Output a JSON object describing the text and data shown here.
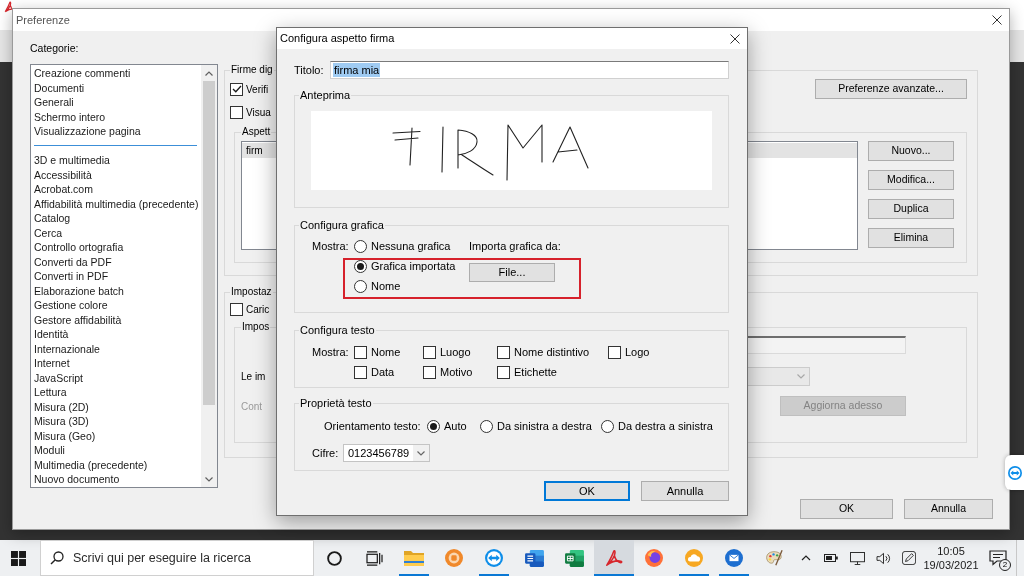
{
  "preferences": {
    "title": "Preferenze",
    "categories_label": "Categorie:",
    "categories": [
      {
        "kind": "item",
        "label": "Creazione commenti"
      },
      {
        "kind": "item",
        "label": "Documenti"
      },
      {
        "kind": "item",
        "label": "Generali"
      },
      {
        "kind": "item",
        "label": "Schermo intero"
      },
      {
        "kind": "item",
        "label": "Visualizzazione pagina"
      },
      {
        "kind": "separator"
      },
      {
        "kind": "item",
        "label": "3D e multimedia"
      },
      {
        "kind": "item",
        "label": "Accessibilità"
      },
      {
        "kind": "item",
        "label": "Acrobat.com"
      },
      {
        "kind": "item",
        "label": "Affidabilità multimedia (precedente)"
      },
      {
        "kind": "item",
        "label": "Catalog"
      },
      {
        "kind": "item",
        "label": "Cerca"
      },
      {
        "kind": "item",
        "label": "Controllo ortografia"
      },
      {
        "kind": "item",
        "label": "Converti da PDF"
      },
      {
        "kind": "item",
        "label": "Converti in PDF"
      },
      {
        "kind": "item",
        "label": "Elaborazione batch"
      },
      {
        "kind": "item",
        "label": "Gestione colore"
      },
      {
        "kind": "item",
        "label": "Gestore affidabilità"
      },
      {
        "kind": "item",
        "label": "Identità"
      },
      {
        "kind": "item",
        "label": "Internazionale"
      },
      {
        "kind": "item",
        "label": "Internet"
      },
      {
        "kind": "item",
        "label": "JavaScript"
      },
      {
        "kind": "item",
        "label": "Lettura"
      },
      {
        "kind": "item",
        "label": "Misura (2D)"
      },
      {
        "kind": "item",
        "label": "Misura (3D)"
      },
      {
        "kind": "item",
        "label": "Misura (Geo)"
      },
      {
        "kind": "item",
        "label": "Moduli"
      },
      {
        "kind": "item",
        "label": "Multimedia (precedente)"
      },
      {
        "kind": "item",
        "label": "Nuovo documento"
      }
    ],
    "signatures_group": {
      "legend": "Firme dig",
      "checkboxes": [
        {
          "label": "Verifi",
          "checked": true
        },
        {
          "label": "Visua",
          "checked": false
        }
      ],
      "advanced_button": "Preferenze avanzate...",
      "appearance_group": {
        "legend": "Aspett",
        "items": [
          {
            "label": "firm",
            "selected": true
          }
        ],
        "buttons": [
          "Nuovo...",
          "Modifica...",
          "Duplica",
          "Elimina"
        ]
      }
    },
    "settings_group": {
      "legend": "Impostaz",
      "checkbox": {
        "label": "Caric",
        "checked": false
      },
      "inner_group": {
        "legend": "Impos",
        "field": {
          "disabled": true
        },
        "dropdown_label": "Le im",
        "dropdown": {
          "disabled": true
        },
        "status_label": {
          "text": "Cont",
          "disabled": true
        },
        "update_button": {
          "label": "Aggiorna adesso",
          "disabled": true
        }
      }
    },
    "buttons": [
      "OK",
      "Annulla"
    ]
  },
  "signature_dialog": {
    "title": "Configura aspetto firma",
    "title_field": {
      "label": "Titolo:",
      "value": "firma mia",
      "text_selected": true
    },
    "preview_group": {
      "legend": "Anteprima"
    },
    "graphic_group": {
      "legend": "Configura grafica",
      "show_label": "Mostra:",
      "options": [
        {
          "label": "Nessuna grafica",
          "selected": false
        },
        {
          "label": "Grafica importata",
          "selected": true
        },
        {
          "label": "Nome",
          "selected": false
        }
      ],
      "import_label": "Importa grafica da:",
      "file_button": "File..."
    },
    "text_group": {
      "legend": "Configura testo",
      "show_label": "Mostra:",
      "options": [
        {
          "label": "Nome",
          "checked": false
        },
        {
          "label": "Luogo",
          "checked": false
        },
        {
          "label": "Nome distintivo",
          "checked": false
        },
        {
          "label": "Logo",
          "checked": false
        },
        {
          "label": "Data",
          "checked": false
        },
        {
          "label": "Motivo",
          "checked": false
        },
        {
          "label": "Etichette",
          "checked": false
        }
      ]
    },
    "text_properties_group": {
      "legend": "Proprietà testo",
      "orientation_label": "Orientamento testo:",
      "orientation_options": [
        {
          "label": "Auto",
          "selected": true
        },
        {
          "label": "Da sinistra a destra",
          "selected": false
        },
        {
          "label": "Da destra a sinistra",
          "selected": false
        }
      ],
      "digits_label": "Cifre:",
      "digits_value": "0123456789"
    },
    "buttons": [
      {
        "label": "OK",
        "default": true
      },
      {
        "label": "Annulla",
        "default": false
      }
    ]
  },
  "taskbar": {
    "search_placeholder": "Scrivi qui per eseguire la ricerca",
    "apps": [
      {
        "kind": "cortana",
        "running": false,
        "selected": false
      },
      {
        "kind": "task-view",
        "running": false,
        "selected": false
      },
      {
        "kind": "file-explorer",
        "running": true,
        "selected": false
      },
      {
        "kind": "round-app",
        "running": false,
        "selected": false
      },
      {
        "kind": "remote-app",
        "running": true,
        "selected": false
      },
      {
        "kind": "word",
        "running": false,
        "selected": false
      },
      {
        "kind": "excel",
        "running": false,
        "selected": false
      },
      {
        "kind": "pdf",
        "running": true,
        "selected": true
      },
      {
        "kind": "browser",
        "running": false,
        "selected": false
      },
      {
        "kind": "cloud-app",
        "running": true,
        "selected": false
      },
      {
        "kind": "mail",
        "running": true,
        "selected": false
      },
      {
        "kind": "paint",
        "running": false,
        "selected": false
      }
    ],
    "time": "10:05",
    "date": "19/03/2021",
    "notification_count": "2"
  }
}
